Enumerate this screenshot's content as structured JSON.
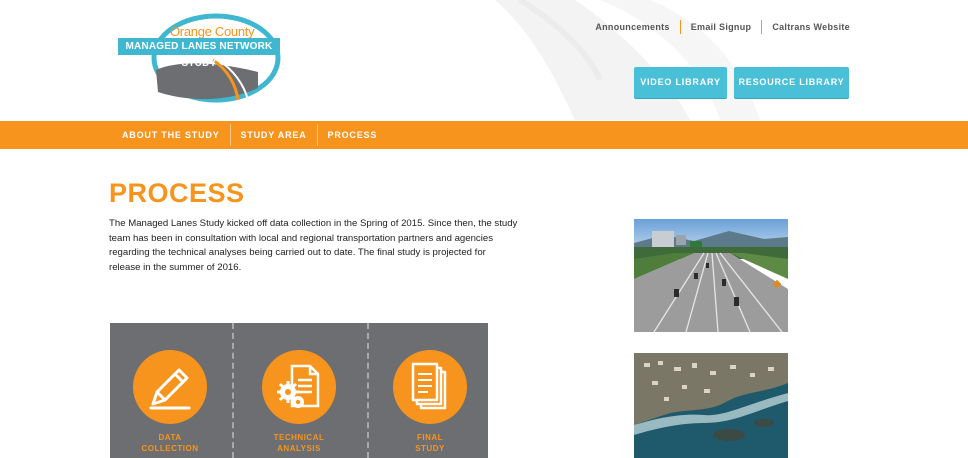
{
  "logo": {
    "line1": "Orange County",
    "line2": "MANAGED LANES NETWORK STUDY"
  },
  "top_links": [
    "Announcements",
    "Email Signup",
    "Caltrans Website"
  ],
  "buttons": {
    "video": "VIDEO LIBRARY",
    "resource": "RESOURCE LIBRARY"
  },
  "nav": [
    "ABOUT THE STUDY",
    "STUDY AREA",
    "PROCESS"
  ],
  "main": {
    "title": "PROCESS",
    "intro": "The Managed Lanes Study kicked off data collection in the Spring of 2015. Since then, the study team has been in consultation with local and regional transportation partners and agencies regarding the technical analyses being carried out to date. The final study is projected for release in the summer of 2016."
  },
  "process_steps": [
    {
      "label": "DATA\nCOLLECTION",
      "icon": "pencil-icon"
    },
    {
      "label": "TECHNICAL\nANALYSIS",
      "icon": "gears-document-icon"
    },
    {
      "label": "FINAL\nSTUDY",
      "icon": "stacked-documents-icon"
    }
  ],
  "colors": {
    "accent": "#f7941d",
    "button": "#49c0d7",
    "process_bg": "#6d6e71"
  }
}
